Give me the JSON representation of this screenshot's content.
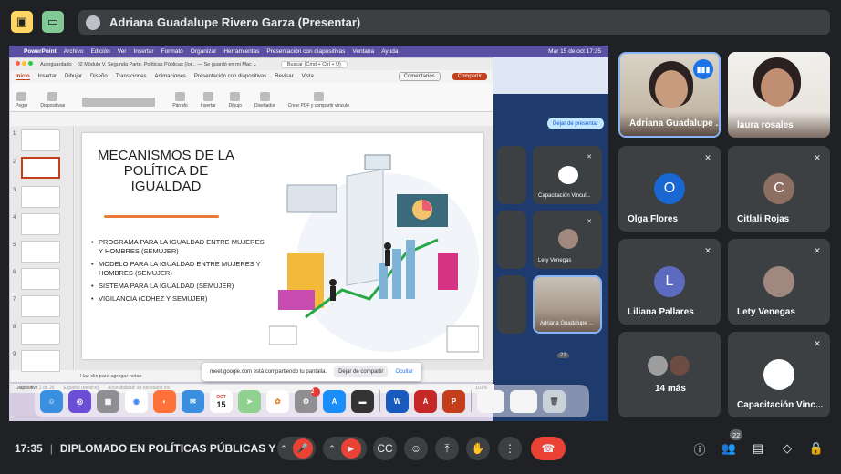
{
  "topbar": {
    "presenter_name": "Adriana Guadalupe Rivero Garza (Presentar)"
  },
  "mac": {
    "menu": [
      "PowerPoint",
      "Archivo",
      "Edición",
      "Ver",
      "Insertar",
      "Formato",
      "Organizar",
      "Herramientas",
      "Presentación con diapositivas",
      "Ventana",
      "Ayuda"
    ],
    "clock": "Mar 15 de oct  17:35"
  },
  "ppt": {
    "autosave": "Autoguardado",
    "doc_title": "02 Módulo V. Segunda Parte. Políticas Públicas (Ior... — Se guardó en mi Mac ⌄",
    "search": "Buscar (Cmd + Ctrl + U)",
    "tabs": [
      "Inicio",
      "Insertar",
      "Dibujar",
      "Diseño",
      "Transiciones",
      "Animaciones",
      "Presentación con diapositivas",
      "Revisar",
      "Vista"
    ],
    "comments": "Comentarios",
    "share": "Compartir",
    "ribbon": [
      "Pegar",
      "Diapositivas",
      "Párrafo",
      "Insertar",
      "Dibujo",
      "Diseñador",
      "Crear PDF y compartir vínculo"
    ],
    "thumb_numbers": [
      "1",
      "2",
      "3",
      "4",
      "5",
      "6",
      "7",
      "8",
      "9"
    ],
    "slide": {
      "title": "MECANISMOS DE LA POLÍTICA DE IGUALDAD",
      "bullets": [
        "PROGRAMA PARA LA IGUALDAD ENTRE MUJERES Y HOMBRES (SEMUJER)",
        "MODELO PARA LA IGUALDAD ENTRE MUJERES Y HOMBRES (SEMUJER)",
        "SISTEMA PARA LA IGUALDAD (SEMUJER)",
        "VIGILANCIA (CDHEZ Y SEMUJER)"
      ]
    },
    "notes": "Haz clic para agregar notas",
    "status": [
      "Diapositiva 2 de 26",
      "Español (México)",
      "Accesibilidad: es necesario inv"
    ],
    "zoom": "101%"
  },
  "share_notice": {
    "text": "meet.google.com está compartiendo tu pantalla.",
    "stop": "Dejar de compartir",
    "hide": "Ocultar"
  },
  "browser_behind": {
    "stop_presenting": "Dejar de presentar",
    "tiles": [
      "Capacitación Vincul...",
      "Lety Venegas",
      "Adriana Guadalupe ..."
    ],
    "count": "22"
  },
  "dock": {
    "calendar_month": "OCT",
    "calendar_day": "15",
    "badge": "2"
  },
  "participants": [
    {
      "name": "Adriana Guadalupe ...",
      "type": "video"
    },
    {
      "name": "laura rosales",
      "type": "video"
    },
    {
      "name": "Olga Flores",
      "initial": "O",
      "color": "#1967d2"
    },
    {
      "name": "Citlali Rojas",
      "initial": "C",
      "color": "#8d6e63"
    },
    {
      "name": "Liliana Pallares",
      "initial": "L",
      "color": "#5c6bc0"
    },
    {
      "name": "Lety Venegas",
      "type": "photo"
    },
    {
      "name": "14 más",
      "type": "group"
    },
    {
      "name": "Capacitación Vinc...",
      "type": "logo"
    }
  ],
  "bottom": {
    "time": "17:35",
    "meeting_title": "DIPLOMADO EN POLÍTICAS PÚBLICAS Y PE...",
    "people_count": "22"
  }
}
